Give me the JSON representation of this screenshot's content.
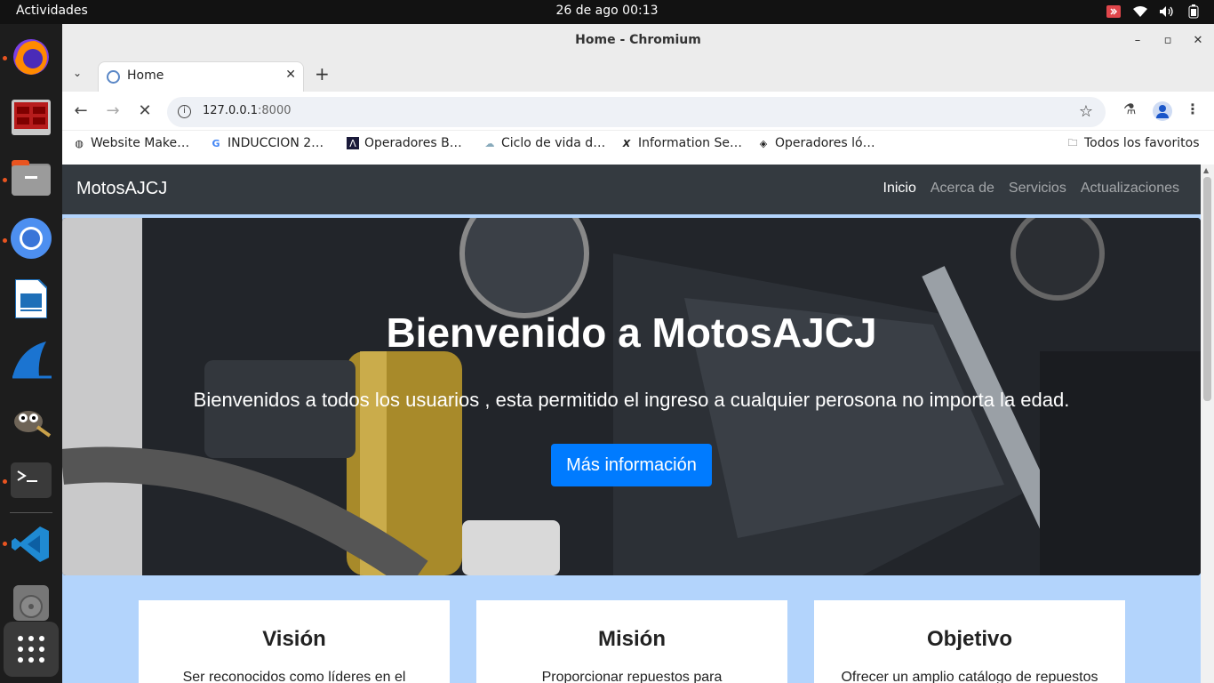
{
  "system": {
    "activities": "Actividades",
    "clock": "26 de ago  00:13"
  },
  "window": {
    "title": "Home - Chromium"
  },
  "tab": {
    "title": "Home"
  },
  "omnibox": {
    "host": "127.0.0.1",
    "port": ":8000"
  },
  "bookmarks": [
    {
      "label": "Website Make…",
      "icon": "globe-icon"
    },
    {
      "label": "INDUCCION 2…",
      "icon": "google-icon"
    },
    {
      "label": "Operadores B…",
      "icon": "site-icon"
    },
    {
      "label": "Ciclo de vida d…",
      "icon": "cloud-icon"
    },
    {
      "label": "Information Se…",
      "icon": "x-icon"
    },
    {
      "label": "Operadores ló…",
      "icon": "diamond-icon"
    }
  ],
  "all_bookmarks": "Todos los favoritos",
  "site": {
    "brand": "MotosAJCJ",
    "nav": [
      "Inicio",
      "Acerca de",
      "Servicios",
      "Actualizaciones"
    ],
    "hero_title": "Bienvenido a MotosAJCJ",
    "hero_subtitle": "Bienvenidos a todos los usuarios , esta permitido el ingreso a cualquier perosona no importa la edad.",
    "hero_button": "Más información",
    "cards": [
      {
        "title": "Visión",
        "text": "Ser reconocidos como líderes en el"
      },
      {
        "title": "Misión",
        "text": "Proporcionar repuestos para"
      },
      {
        "title": "Objetivo",
        "text": "Ofrecer un amplio catálogo de repuestos"
      }
    ]
  },
  "colors": {
    "primary": "#007bff",
    "navbar": "#343a40",
    "page_bg": "#b3d4fc"
  }
}
